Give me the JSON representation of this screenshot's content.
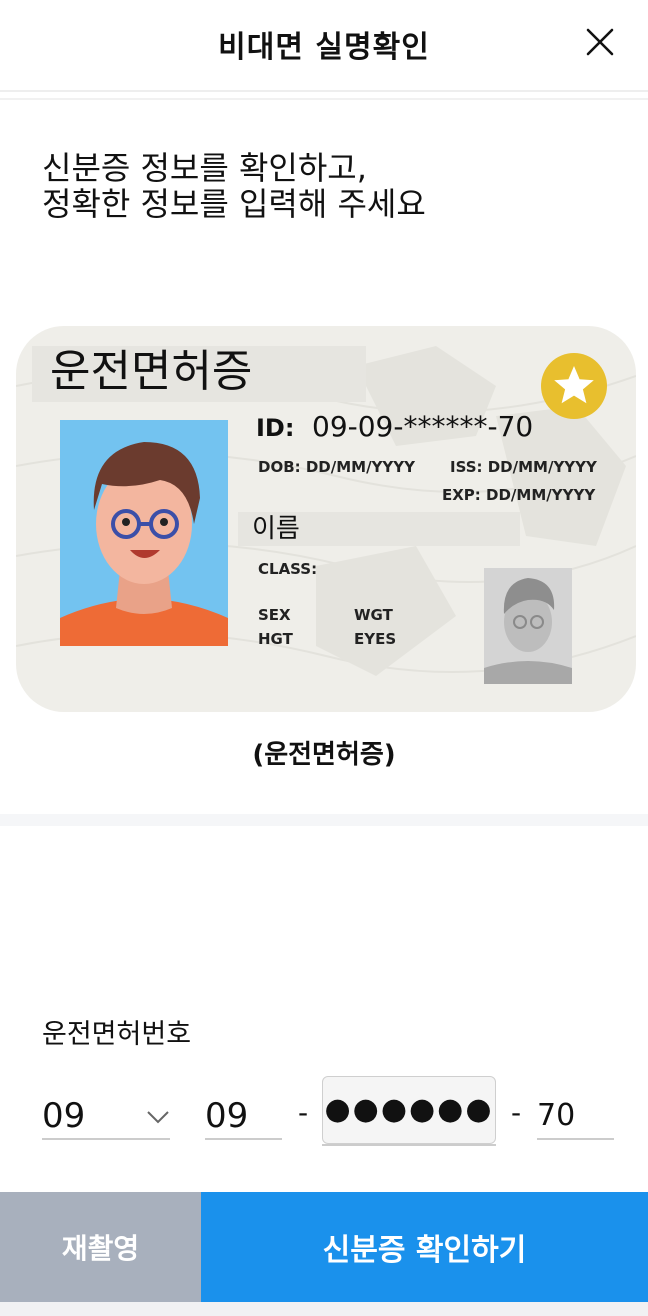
{
  "header": {
    "title": "비대면 실명확인"
  },
  "instruction": "신분증 정보를 확인하고,\n정확한 정보를 입력해 주세요",
  "id_card": {
    "title": "운전면허증",
    "id_label": "ID:",
    "id_value": "09-09-******-70",
    "dob": "DOB: DD/MM/YYYY",
    "iss": "ISS: DD/MM/YYYY",
    "exp": "EXP: DD/MM/YYYY",
    "name": "이름",
    "class_label": "CLASS:",
    "sex_label": "SEX",
    "wgt_label": "WGT",
    "hgt_label": "HGT",
    "eyes_label": "EYES"
  },
  "card_caption": "(운전면허증)",
  "license_field": {
    "label": "운전면허번호",
    "region": "09",
    "part2": "09",
    "part3_masked": "●●●●●●",
    "part4": "70",
    "separator": "-"
  },
  "buttons": {
    "retake": "재촬영",
    "confirm": "신분증 확인하기"
  },
  "colors": {
    "primary": "#1a91ec",
    "secondary": "#a8b0bd",
    "star": "#e8bf2e"
  }
}
